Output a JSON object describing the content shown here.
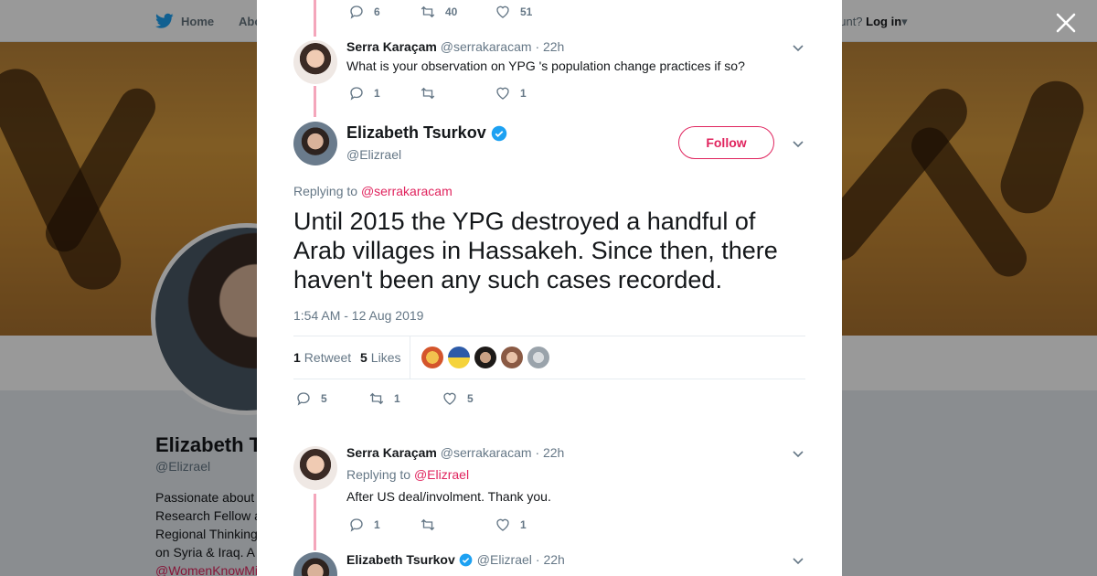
{
  "nav": {
    "home_label": "Home",
    "about_label": "Abo",
    "login_prompt": "ccount?",
    "login_label": "Log in"
  },
  "profile": {
    "name": "Elizabeth Ts",
    "handle": "@Elizrael",
    "bio_lines": [
      "Passionate about",
      "Research Fellow a",
      "Regional Thinking",
      "on Syria & Iraq. A"
    ],
    "bio_link": "@WomenKnowMi"
  },
  "top_actions": {
    "replies": "6",
    "retweets": "40",
    "likes": "51"
  },
  "tweet1": {
    "name": "Serra Karaçam",
    "handle": "@serrakaracam",
    "time": "· 22h",
    "text": "What is your observation on YPG 's population change practices if so?",
    "replies": "1",
    "retweets": "",
    "likes": "1"
  },
  "main_tweet": {
    "name": "Elizabeth Tsurkov",
    "handle": "@Elizrael",
    "follow_label": "Follow",
    "replying_prefix": "Replying to",
    "replying_to": "@serrakaracam",
    "text": "Until 2015 the YPG destroyed a handful of Arab villages in Hassakeh. Since then, there haven't been any such cases recorded.",
    "timestamp": "1:54 AM - 12 Aug 2019",
    "retweet_count": "1",
    "retweet_label": "Retweet",
    "like_count": "5",
    "like_label": "Likes",
    "replies": "5",
    "retweets": "1",
    "likes": "5"
  },
  "tweet3": {
    "name": "Serra Karaçam",
    "handle": "@serrakaracam",
    "time": "· 22h",
    "replying_prefix": "Replying to",
    "replying_to": "@Elizrael",
    "text": "After US deal/involment. Thank you.",
    "replies": "1",
    "retweets": "",
    "likes": "1"
  },
  "tweet4": {
    "name": "Elizabeth Tsurkov",
    "handle": "@Elizrael",
    "time": "· 22h"
  },
  "colors": {
    "accent": "#e0245e",
    "verified": "#1da1f2",
    "muted": "#657786",
    "thread": "#f4a6bb"
  }
}
